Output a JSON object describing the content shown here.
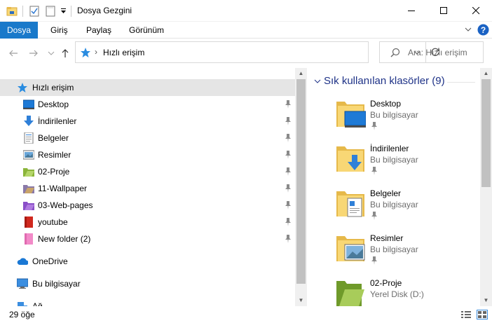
{
  "window": {
    "title": "Dosya Gezgini"
  },
  "ribbon": {
    "tabs": [
      "Dosya",
      "Giriş",
      "Paylaş",
      "Görünüm"
    ]
  },
  "address": {
    "crumb": "Hızlı erişim"
  },
  "search": {
    "placeholder": "Ara: Hızlı erişim"
  },
  "nav": {
    "quick_access": "Hızlı erişim",
    "items": [
      "Desktop",
      "İndirilenler",
      "Belgeler",
      "Resimler",
      "02-Proje",
      "11-Wallpaper",
      "03-Web-pages",
      "youtube",
      "New folder (2)"
    ],
    "onedrive": "OneDrive",
    "this_pc": "Bu bilgisayar",
    "network": "Ağ"
  },
  "content": {
    "group_header": "Sık kullanılan klasörler (9)",
    "tiles": [
      {
        "name": "Desktop",
        "sub": "Bu bilgisayar"
      },
      {
        "name": "İndirilenler",
        "sub": "Bu bilgisayar"
      },
      {
        "name": "Belgeler",
        "sub": "Bu bilgisayar"
      },
      {
        "name": "Resimler",
        "sub": "Bu bilgisayar"
      },
      {
        "name": "02-Proje",
        "sub": "Yerel Disk (D:)"
      }
    ]
  },
  "status": {
    "count": "29 öğe"
  },
  "colors": {
    "accent": "#1979ca",
    "folder": "#f8d775",
    "header_blue": "#1e3287"
  }
}
